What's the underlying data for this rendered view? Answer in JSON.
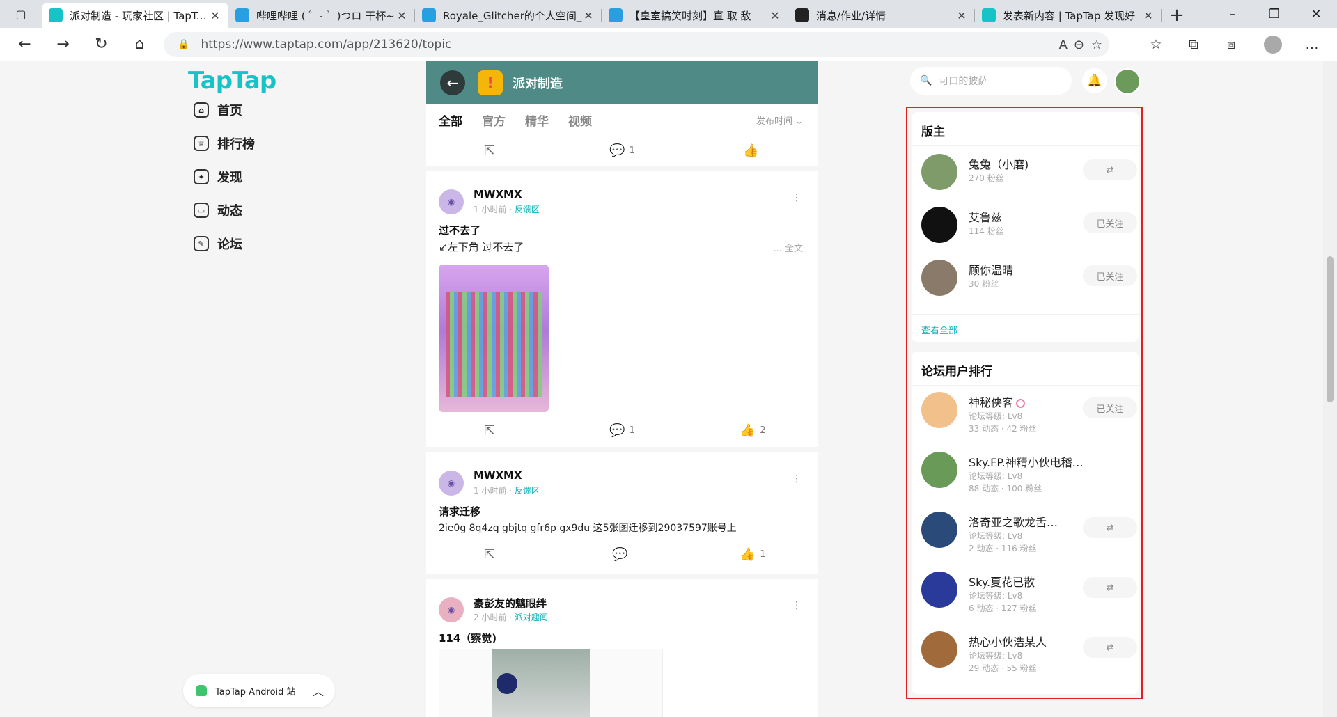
{
  "browser": {
    "tabs": [
      {
        "title": "派对制造 - 玩家社区 | TapTap",
        "favicon": "TapTap",
        "color": "#16c4c8",
        "active": true
      },
      {
        "title": "哔哩哔哩 ( ゜- ゜)つロ 干杯~",
        "favicon": "bili",
        "color": "#2a9fe0",
        "active": false
      },
      {
        "title": "Royale_Glitcher的个人空间_",
        "favicon": "bili",
        "color": "#2a9fe0",
        "active": false
      },
      {
        "title": "【皇室搞笑时刻】直 取 敌 ",
        "favicon": "bili",
        "color": "#2a9fe0",
        "active": false
      },
      {
        "title": "消息/作业/详情",
        "favicon": "晓",
        "color": "#222222",
        "active": false
      },
      {
        "title": "发表新内容 | TapTap 发现好",
        "favicon": "TapTap",
        "color": "#16c4c8",
        "active": false
      }
    ],
    "url": "https://www.taptap.com/app/213620/topic"
  },
  "site": {
    "logo": "TapTap",
    "nav": [
      {
        "label": "首页",
        "icon": "home-icon"
      },
      {
        "label": "排行榜",
        "icon": "trophy-icon"
      },
      {
        "label": "发现",
        "icon": "discover-icon"
      },
      {
        "label": "动态",
        "icon": "feed-icon"
      },
      {
        "label": "论坛",
        "icon": "forum-icon"
      }
    ],
    "android_download": "TapTap Android 站"
  },
  "forum": {
    "game_name": "派对制造",
    "tabs": [
      "全部",
      "官方",
      "精华",
      "视频"
    ],
    "sort": "发布时间",
    "posts": [
      {
        "partial": true,
        "comments": "1",
        "likes": ""
      },
      {
        "author": "MWXMX",
        "time": "1 小时前",
        "tag": "反馈区",
        "title": "过不去了",
        "body": "↙左下角 过不去了",
        "more": "... 全文",
        "comments": "1",
        "likes": "2"
      },
      {
        "author": "MWXMX",
        "time": "1 小时前",
        "tag": "反馈区",
        "title": "请求迁移",
        "body": "2ie0g 8q4zq gbjtq gfr6p gx9du 这5张图迁移到29037597账号上",
        "comments": "",
        "likes": "1"
      },
      {
        "author": "豪彭友的魑眼绊",
        "time": "2 小时前",
        "tag": "派对趣闻",
        "title": "114（察觉)"
      }
    ]
  },
  "sidebar": {
    "search_placeholder": "可口的披萨",
    "moderators": {
      "heading": "版主",
      "users": [
        {
          "name": "兔兔（小磨)",
          "fans": "270 粉丝",
          "button": "⇄",
          "color": "#7f9b6a"
        },
        {
          "name": "艾鲁兹",
          "fans": "114 粉丝",
          "button": "已关注",
          "color": "#111111"
        },
        {
          "name": "顾你温晴",
          "fans": "30 粉丝",
          "button": "已关注",
          "color": "#8a7a6a"
        }
      ],
      "see_all": "查看全部"
    },
    "ranking": {
      "heading": "论坛用户排行",
      "users": [
        {
          "name": "神秘侠客",
          "level": "论坛等级: Lv8",
          "stats": "33 动态 · 42 粉丝",
          "button": "已关注",
          "color": "#f2c08a"
        },
        {
          "name": "Sky.FP.神精小伙电稽蓝莓",
          "level": "论坛等级: Lv8",
          "stats": "88 动态 · 100 粉丝",
          "button": "",
          "color": "#6a9a58"
        },
        {
          "name": "洛奇亚之歌龙舌…",
          "level": "论坛等级: Lv8",
          "stats": "2 动态 · 116 粉丝",
          "button": "⇄",
          "color": "#2a4a7a"
        },
        {
          "name": "Sky.夏花已散",
          "level": "论坛等级: Lv8",
          "stats": "6 动态 · 127 粉丝",
          "button": "⇄",
          "color": "#2a3a9a"
        },
        {
          "name": "热心小伙浩某人",
          "level": "论坛等级: Lv8",
          "stats": "29 动态 · 55 粉丝",
          "button": "⇄",
          "color": "#a06a3a"
        }
      ]
    }
  }
}
